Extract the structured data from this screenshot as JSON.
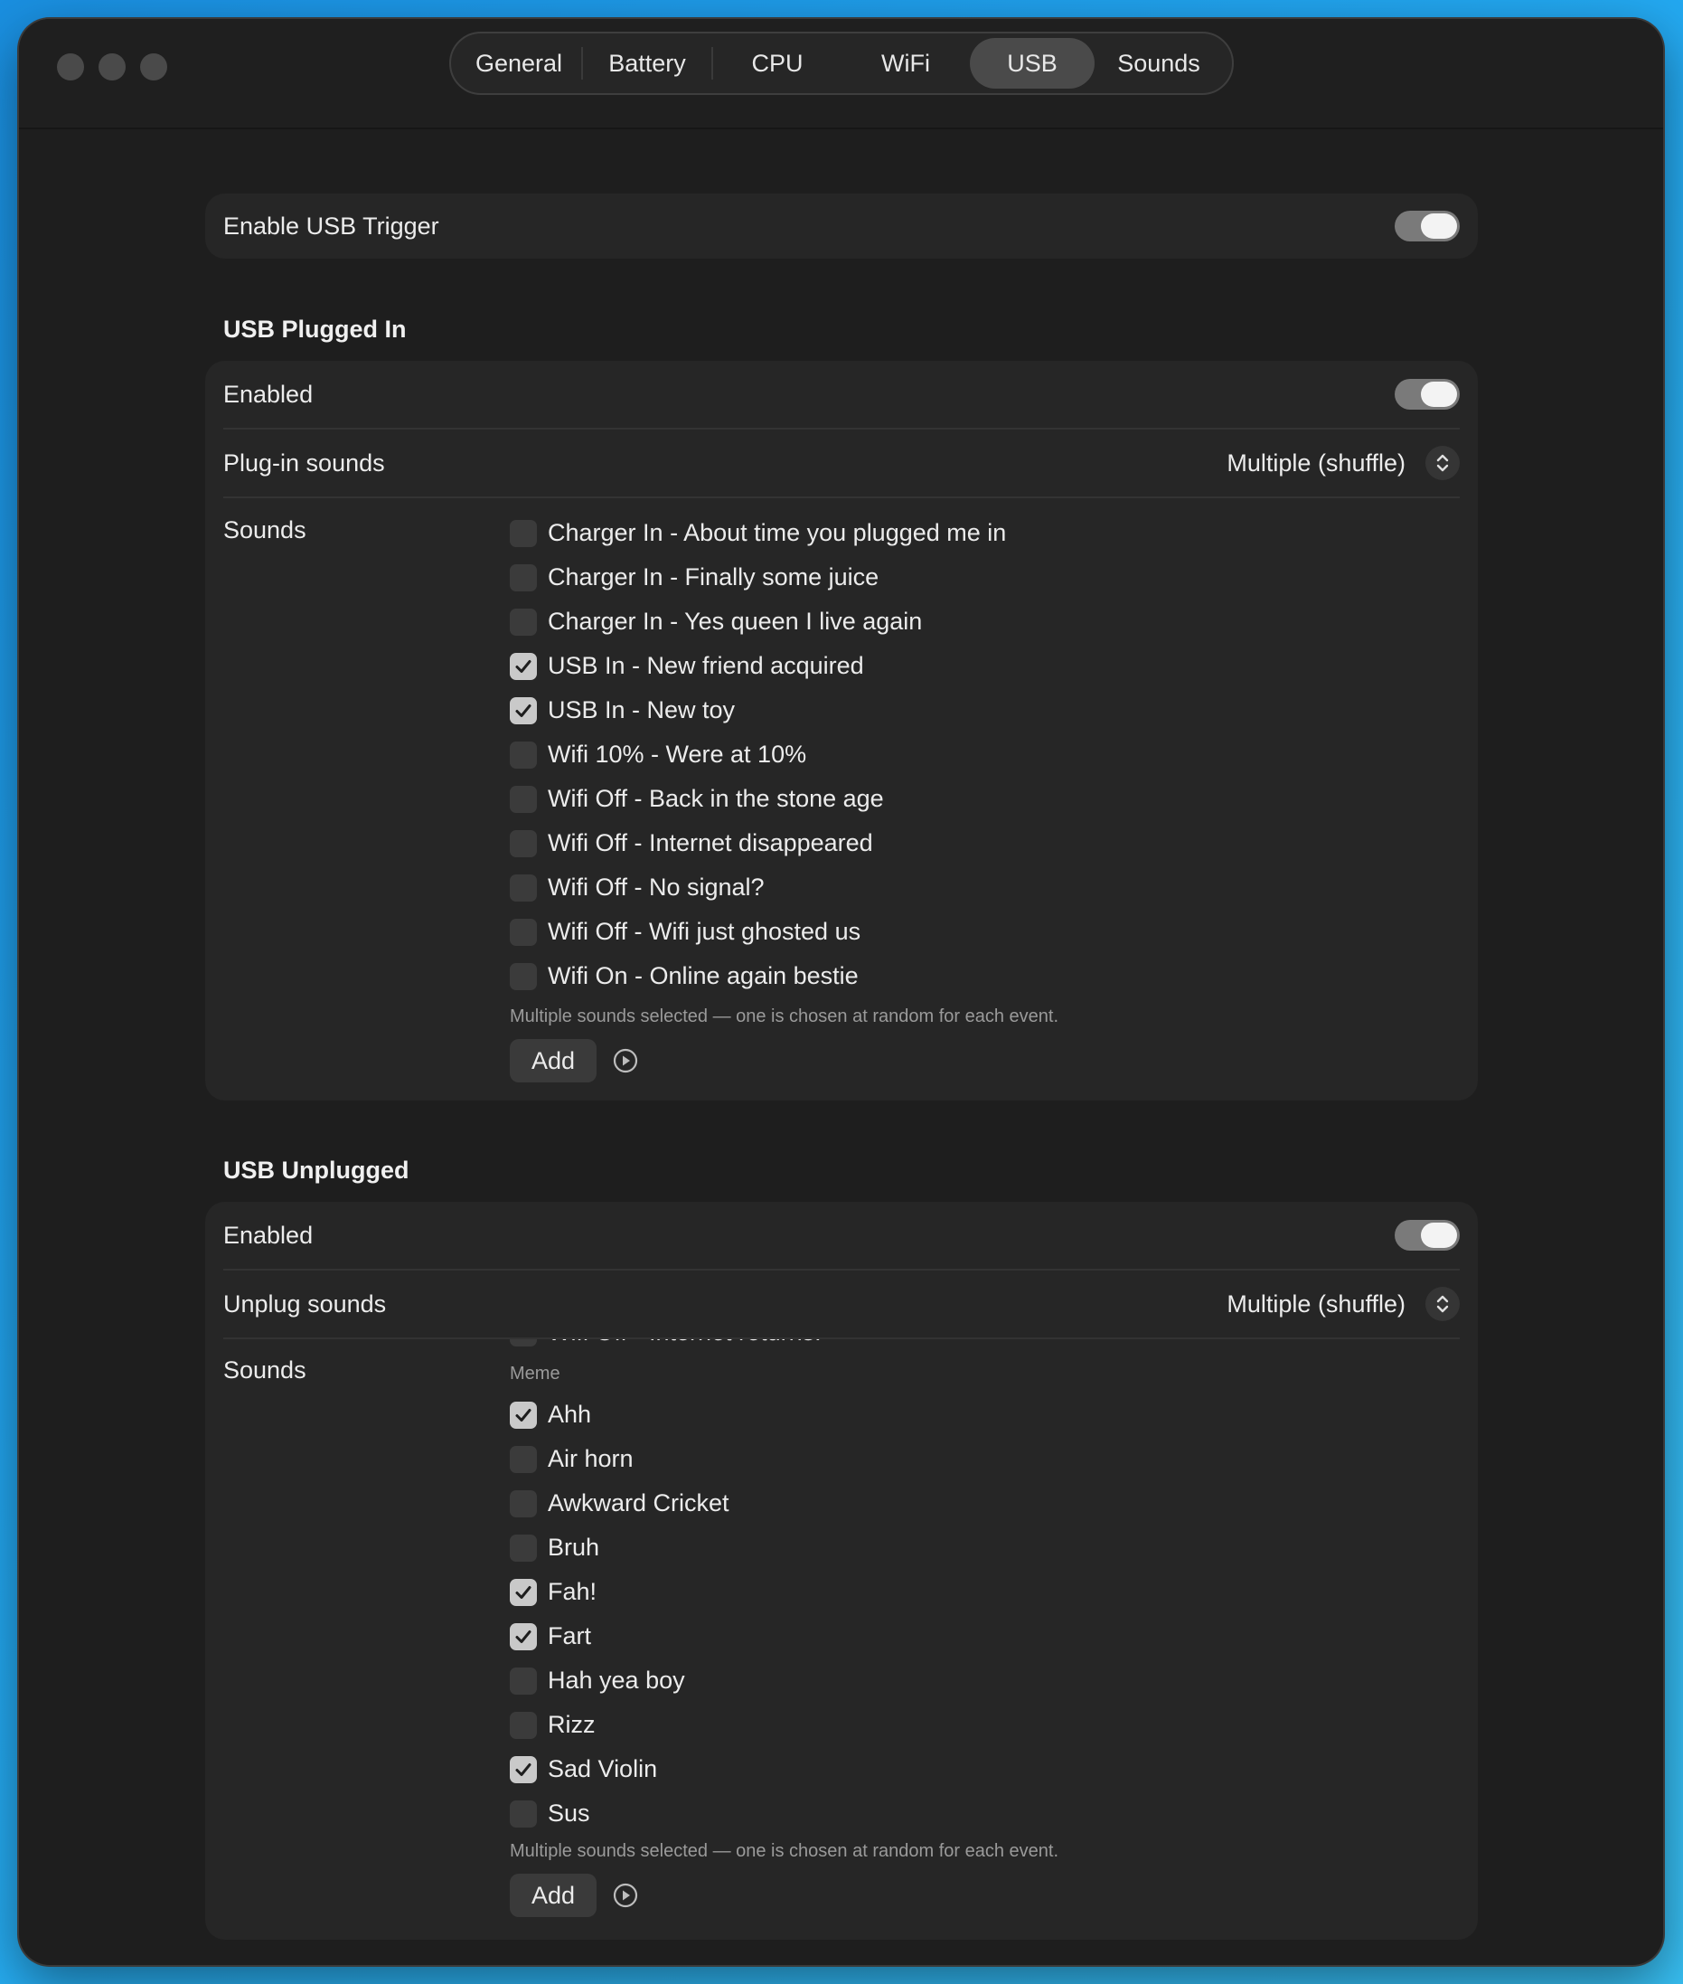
{
  "tabs": [
    "General",
    "Battery",
    "CPU",
    "WiFi",
    "USB",
    "Sounds"
  ],
  "active_tab": "USB",
  "enable_trigger": {
    "label": "Enable USB Trigger",
    "on": true
  },
  "plugged": {
    "title": "USB Plugged In",
    "enabled_label": "Enabled",
    "enabled_on": true,
    "mode_label": "Plug-in sounds",
    "mode_value": "Multiple (shuffle)",
    "sounds_label": "Sounds",
    "items": [
      {
        "label": "Charger In - About time you plugged me in",
        "checked": false
      },
      {
        "label": "Charger In - Finally some juice",
        "checked": false
      },
      {
        "label": "Charger In - Yes queen I live again",
        "checked": false
      },
      {
        "label": "USB In - New friend acquired",
        "checked": true
      },
      {
        "label": "USB In - New toy",
        "checked": true
      },
      {
        "label": "Wifi 10% - Were at 10%",
        "checked": false
      },
      {
        "label": "Wifi Off - Back in the stone age",
        "checked": false
      },
      {
        "label": "Wifi Off - Internet disappeared",
        "checked": false
      },
      {
        "label": "Wifi Off - No signal?",
        "checked": false
      },
      {
        "label": "Wifi Off - Wifi just ghosted us",
        "checked": false
      },
      {
        "label": "Wifi On - Online again bestie",
        "checked": false
      }
    ],
    "note": "Multiple sounds selected — one is chosen at random for each event.",
    "add_label": "Add"
  },
  "unplugged": {
    "title": "USB Unplugged",
    "enabled_label": "Enabled",
    "enabled_on": true,
    "mode_label": "Unplug sounds",
    "mode_value": "Multiple (shuffle)",
    "sounds_label": "Sounds",
    "partial_top_item": "Wifi Off - Internet returns!",
    "group_header": "Meme",
    "items": [
      {
        "label": "Ahh",
        "checked": true
      },
      {
        "label": "Air horn",
        "checked": false
      },
      {
        "label": "Awkward Cricket",
        "checked": false
      },
      {
        "label": "Bruh",
        "checked": false
      },
      {
        "label": "Fah!",
        "checked": true
      },
      {
        "label": "Fart",
        "checked": true
      },
      {
        "label": "Hah yea boy",
        "checked": false
      },
      {
        "label": "Rizz",
        "checked": false
      },
      {
        "label": "Sad Violin",
        "checked": true
      },
      {
        "label": "Sus",
        "checked": false
      }
    ],
    "note": "Multiple sounds selected — one is chosen at random for each event.",
    "add_label": "Add"
  },
  "colors": {
    "accent_toggle": "#7a7a7a",
    "check_on": "#c9c9c9",
    "window": "#1e1e1e",
    "card": "#262626"
  }
}
